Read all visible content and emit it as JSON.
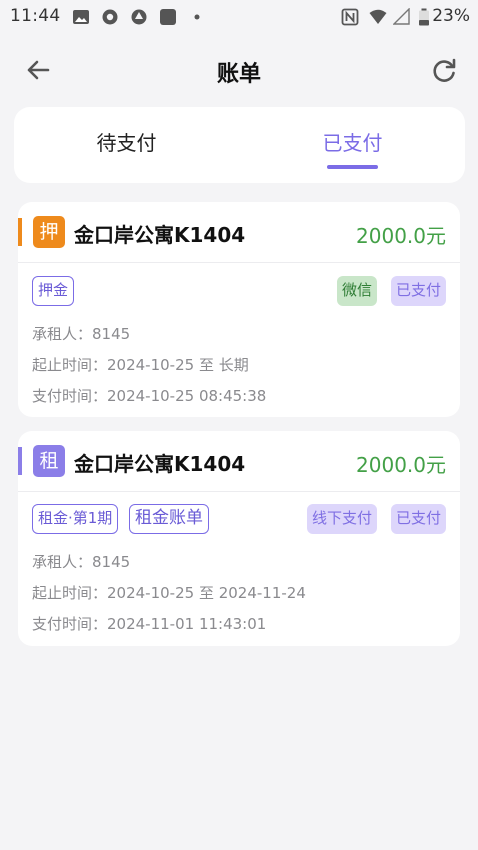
{
  "status_bar": {
    "time": "11:44",
    "battery": "23%",
    "icons": [
      "image-icon",
      "record-icon",
      "aperture-icon",
      "app-icon",
      "dot-icon",
      "nfc-icon",
      "wifi-icon",
      "signal-icon",
      "battery-icon"
    ]
  },
  "header": {
    "title": "账单",
    "back_icon": "arrow-left-icon",
    "refresh_icon": "refresh-icon"
  },
  "tabs": [
    {
      "label": "待支付",
      "active": false
    },
    {
      "label": "已支付",
      "active": true
    }
  ],
  "colors": {
    "accent": "#7b6ce6",
    "amount": "#43a047",
    "deposit_badge": "#ee8a1c",
    "rent_badge": "#8b7ee8"
  },
  "bills": [
    {
      "badge": "押",
      "property": "金口岸公寓K1404",
      "amount": "2000.0元",
      "tags_left": [
        "押金"
      ],
      "tags_right": [
        "微信",
        "已支付"
      ],
      "tenant": "承租人：8145",
      "period": "起止时间：2024-10-25 至 长期",
      "paid_time": "支付时间：2024-10-25 08:45:38"
    },
    {
      "badge": "租",
      "property": "金口岸公寓K1404",
      "amount": "2000.0元",
      "tags_left": [
        "租金·第1期",
        "租金账单"
      ],
      "tags_right": [
        "线下支付",
        "已支付"
      ],
      "tenant": "承租人：8145",
      "period": "起止时间：2024-10-25 至 2024-11-24",
      "paid_time": "支付时间：2024-11-01 11:43:01"
    }
  ]
}
